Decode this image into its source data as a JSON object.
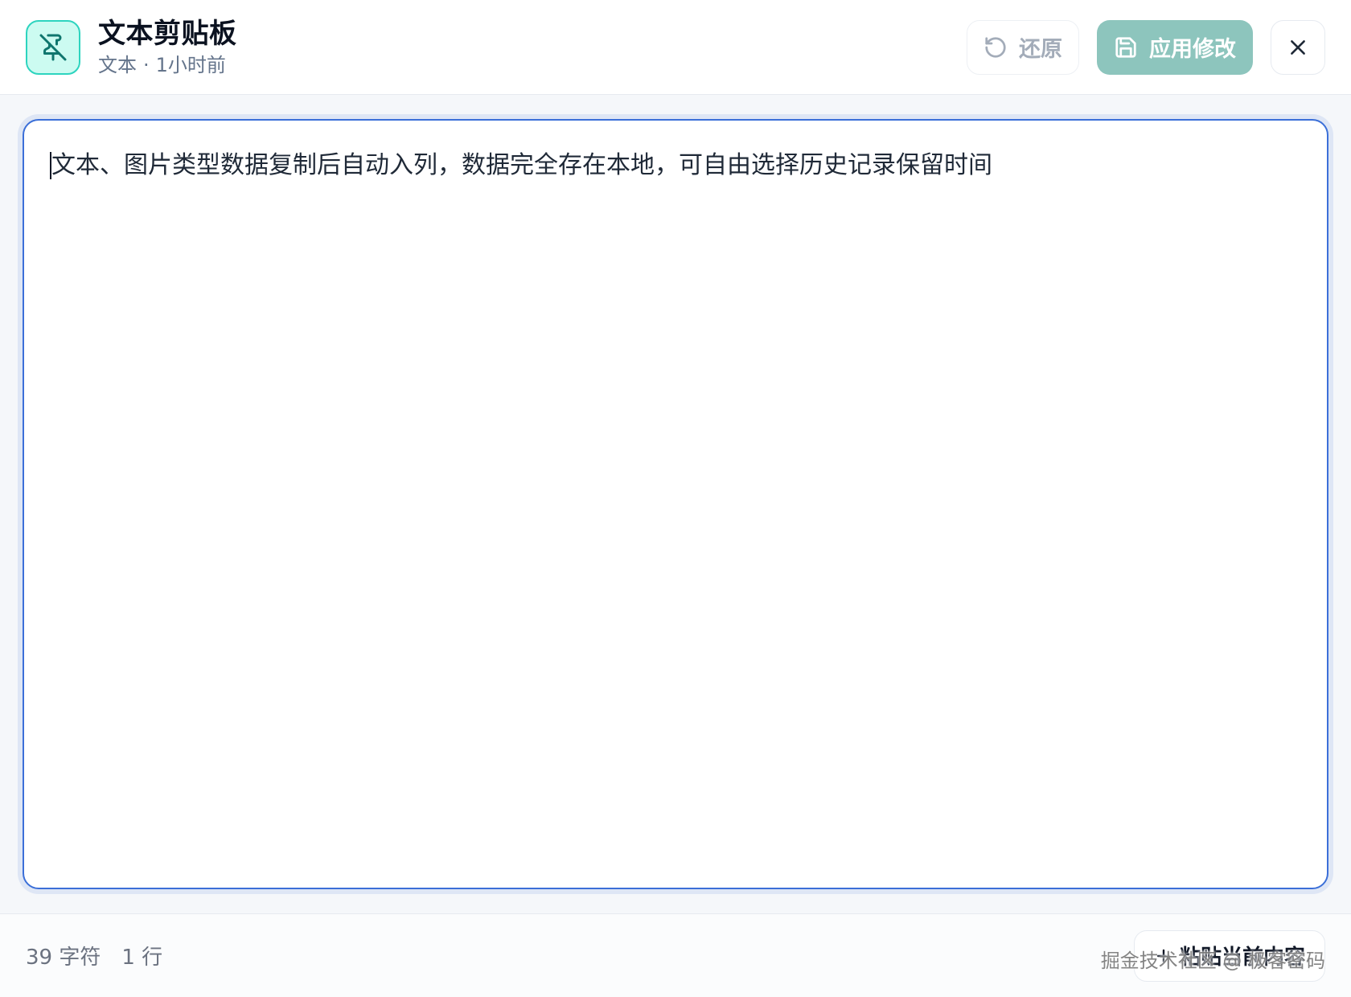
{
  "header": {
    "app_icon": "pin-off-icon",
    "title": "文本剪贴板",
    "subtitle_type": "文本",
    "subtitle_separator": "·",
    "subtitle_time": "1小时前",
    "restore_label": "还原",
    "restore_icon": "rotate-ccw-icon",
    "apply_label": "应用修改",
    "apply_icon": "save-icon",
    "close_icon": "close-icon"
  },
  "editor": {
    "content": "文本、图片类型数据复制后自动入列，数据完全存在本地，可自由选择历史记录保留时间"
  },
  "footer": {
    "char_count": "39 字符",
    "line_count": "1 行",
    "paste_label": "粘贴当前内容",
    "paste_icon": "plus-icon",
    "watermark": "掘金技术社区 @ 极客密码"
  },
  "colors": {
    "accent": "#3b6fd8",
    "apply_button": "#8dc5bd",
    "app_icon_bg": "#ccfbf1",
    "app_icon_stroke": "#0f766e"
  }
}
